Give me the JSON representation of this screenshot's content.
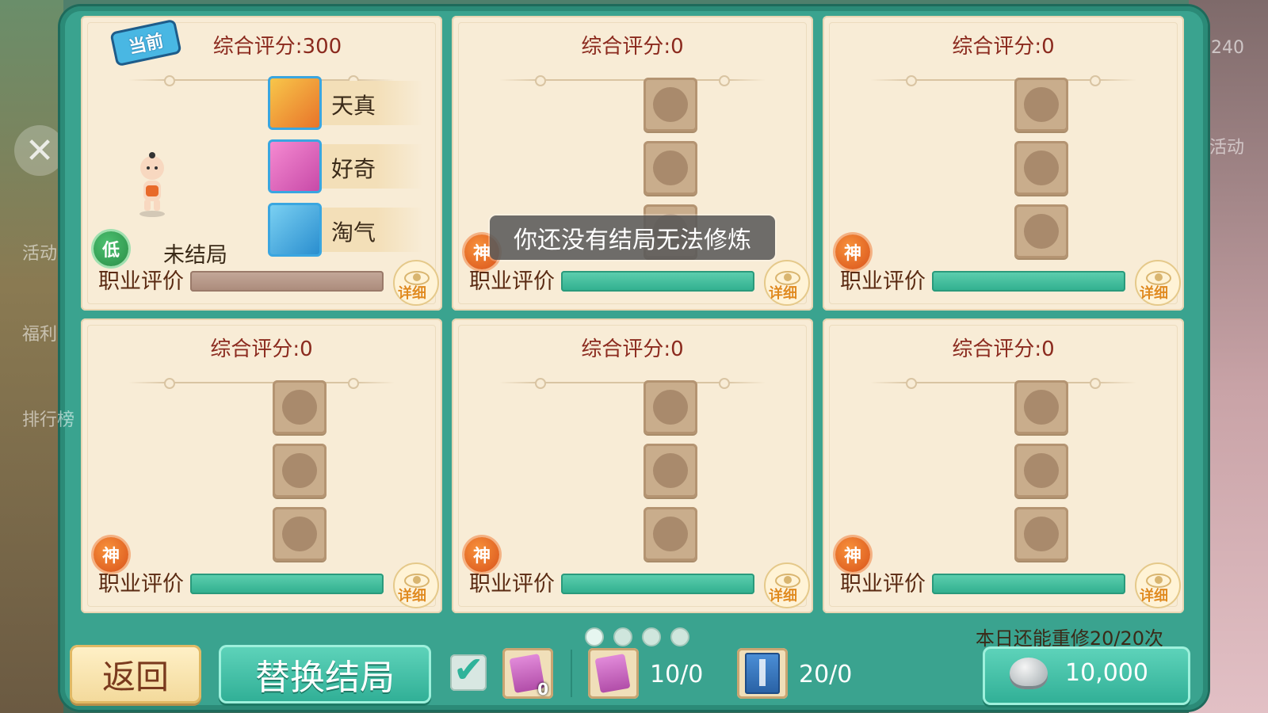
{
  "background": {
    "side_labels": [
      "活动",
      "福利",
      "排行榜"
    ],
    "right_number": "240",
    "right_label": "活动"
  },
  "current_tag": "当前",
  "cards": [
    {
      "score": "综合评分:300",
      "badge": "低",
      "ending_status": "未结局",
      "traits": [
        "天真",
        "好奇",
        "淘气"
      ],
      "eval_label": "职业评价",
      "eval_bar": "grey",
      "detail_label": "详细"
    },
    {
      "score": "综合评分:0",
      "badge": "神",
      "eval_label": "职业评价",
      "eval_bar": "green",
      "detail_label": "详细"
    },
    {
      "score": "综合评分:0",
      "badge": "神",
      "eval_label": "职业评价",
      "eval_bar": "green",
      "detail_label": "详细"
    },
    {
      "score": "综合评分:0",
      "badge": "神",
      "eval_label": "职业评价",
      "eval_bar": "green",
      "detail_label": "详细"
    },
    {
      "score": "综合评分:0",
      "badge": "神",
      "eval_label": "职业评价",
      "eval_bar": "green",
      "detail_label": "详细"
    },
    {
      "score": "综合评分:0",
      "badge": "神",
      "eval_label": "职业评价",
      "eval_bar": "green",
      "detail_label": "详细"
    }
  ],
  "toast": "你还没有结局无法修炼",
  "pagination": {
    "pages": 4,
    "active": 1
  },
  "remaining": "本日还能重修20/20次",
  "buttons": {
    "back": "返回",
    "replace": "替换结局"
  },
  "checkbox": {
    "checked": true
  },
  "items": [
    {
      "icon": "purple-scroll-icon",
      "count": "0"
    },
    {
      "icon": "purple-scroll-icon",
      "qty": "10/0"
    },
    {
      "icon": "blue-book-icon",
      "qty": "20/0"
    }
  ],
  "currency": {
    "icon": "silver-ingot-icon",
    "value": "10,000"
  },
  "colors": {
    "accent": "#3aa38f",
    "card": "#f8ecd6",
    "title": "#8b2a1e",
    "bar": "#2fae8d"
  }
}
